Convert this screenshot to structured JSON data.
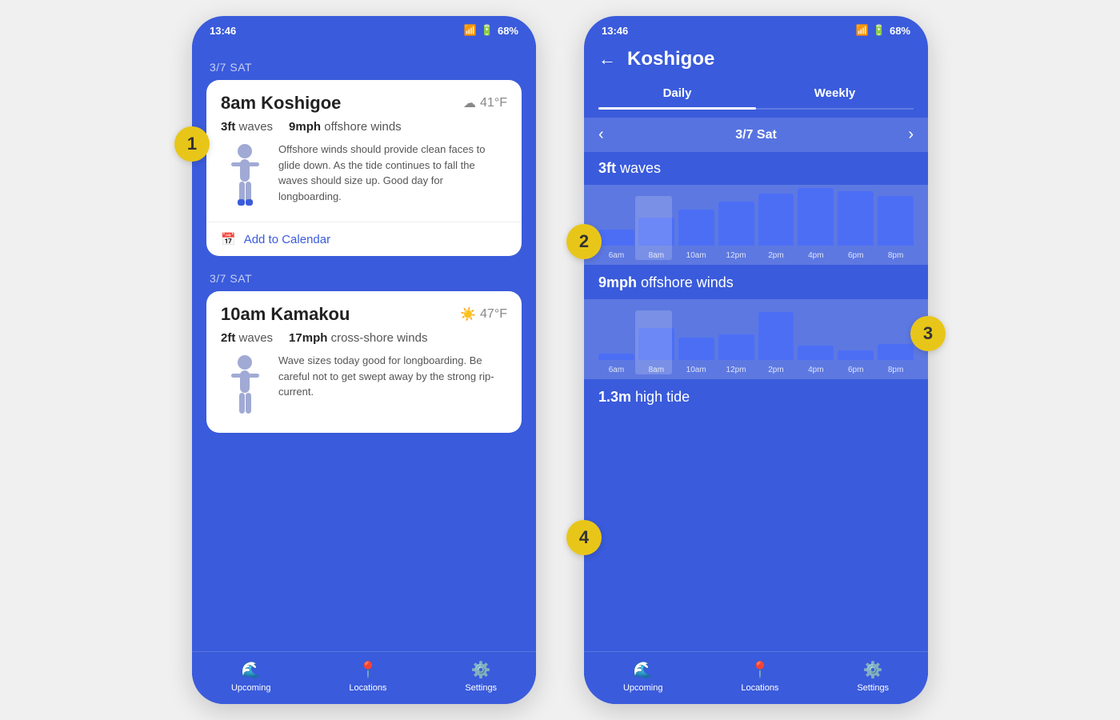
{
  "left_phone": {
    "status": {
      "time": "13:46",
      "signal": "📶",
      "battery": "68%"
    },
    "badge1": "1",
    "date1": "3/7 SAT",
    "card1": {
      "time": "8am",
      "location": "Koshigoe",
      "weather_icon": "☁",
      "temp": "41°F",
      "waves": "3ft",
      "waves_label": "waves",
      "wind_speed": "9mph",
      "wind_label": "offshore winds",
      "description": "Offshore winds should provide clean faces to glide down. As the tide continues to fall the waves should size up. Good day for longboarding.",
      "calendar_label": "Add to Calendar"
    },
    "date2": "3/7 SAT",
    "card2": {
      "time": "10am",
      "location": "Kamakou",
      "weather_icon": "☀",
      "temp": "47°F",
      "waves": "2ft",
      "waves_label": "waves",
      "wind_speed": "17mph",
      "wind_label": "cross-shore winds",
      "description": "Wave sizes today good for longboarding. Be careful not to get swept away by the strong rip-current."
    },
    "nav": {
      "upcoming": "Upcoming",
      "locations": "Locations",
      "settings": "Settings"
    }
  },
  "right_phone": {
    "status": {
      "time": "13:46",
      "battery": "68%"
    },
    "badge2": "2",
    "badge3": "3",
    "badge4": "4",
    "header": {
      "back": "←",
      "title": "Koshigoe"
    },
    "tabs": {
      "daily": "Daily",
      "weekly": "Weekly"
    },
    "date_nav": {
      "left": "‹",
      "date": "3/7 Sat",
      "right": "›"
    },
    "waves_section": {
      "bold": "3ft",
      "label": "waves"
    },
    "wave_chart": {
      "times": [
        "6am",
        "8am",
        "10am",
        "12pm",
        "2pm",
        "4pm",
        "6pm",
        "8pm"
      ],
      "heights": [
        20,
        35,
        45,
        55,
        65,
        72,
        68,
        62
      ]
    },
    "wind_section": {
      "bold": "9mph",
      "label": "offshore winds"
    },
    "wind_chart": {
      "times": [
        "6am",
        "8am",
        "10am",
        "12pm",
        "2pm",
        "4pm",
        "6pm",
        "8pm"
      ],
      "heights": [
        8,
        40,
        28,
        32,
        60,
        18,
        12,
        20
      ]
    },
    "tide_section": {
      "bold": "1.3m",
      "label": "high tide"
    },
    "nav": {
      "upcoming": "Upcoming",
      "locations": "Locations",
      "settings": "Settings"
    }
  }
}
